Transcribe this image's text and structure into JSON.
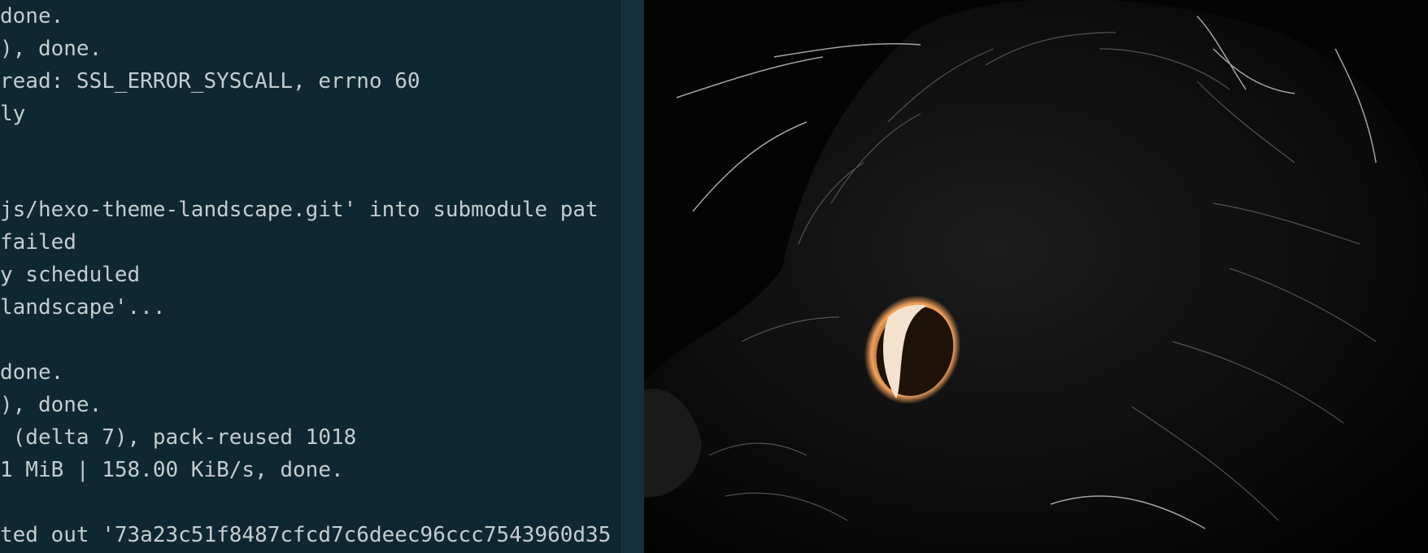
{
  "terminal": {
    "lines": [
      "done.",
      "), done.",
      "read: SSL_ERROR_SYSCALL, errno 60",
      "ly",
      "",
      "",
      "js/hexo-theme-landscape.git' into submodule pat",
      "failed",
      "y scheduled",
      "landscape'...",
      "",
      "done.",
      "), done.",
      " (delta 7), pack-reused 1018",
      "1 MiB | 158.00 KiB/s, done.",
      "",
      "ted out '73a23c51f8487cfcd7c6deec96ccc7543960d35"
    ]
  },
  "colors": {
    "terminal_bg": "#0e2733",
    "terminal_text": "#c4ccd0",
    "divider": "#14303d",
    "eye_glow": "#f2a15a"
  },
  "photo": {
    "subject_icon": "cat-photo"
  }
}
